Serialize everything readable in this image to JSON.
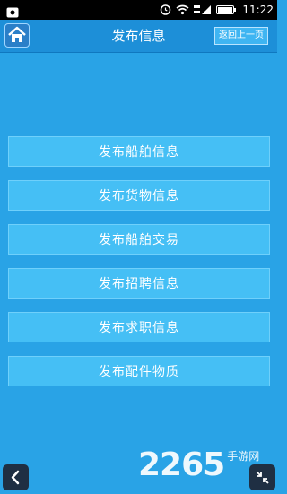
{
  "statusbar": {
    "time": "11:22",
    "icons": [
      "notification-icon",
      "alarm-icon",
      "wifi-icon",
      "signal-icon",
      "battery-icon"
    ]
  },
  "header": {
    "title": "发布信息",
    "back_label": "返回上一页",
    "home_icon": "home-icon"
  },
  "menu": {
    "items": [
      {
        "label": "发布船舶信息"
      },
      {
        "label": "发布货物信息"
      },
      {
        "label": "发布船舶交易"
      },
      {
        "label": "发布招聘信息"
      },
      {
        "label": "发布求职信息"
      },
      {
        "label": "发布配件物质"
      }
    ]
  },
  "overlay": {
    "back_icon": "chevron-left-icon",
    "collapse_icon": "collapse-icon"
  },
  "watermark": {
    "number": "2265",
    "suffix": "手游网"
  },
  "colors": {
    "background": "#29a3e6",
    "header": "#1d8fd8",
    "button": "#45bff5"
  }
}
